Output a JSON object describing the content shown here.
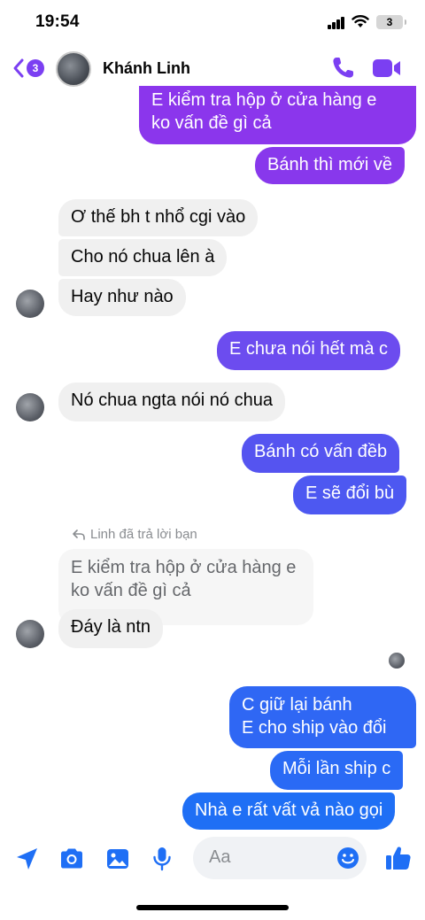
{
  "status": {
    "time": "19:54",
    "battery": "3"
  },
  "header": {
    "back_count": "3",
    "contact_name": "Khánh Linh"
  },
  "messages": [
    {
      "from": "me",
      "lines": [
        "E kiểm tra hộp ở cửa hàng e",
        "ko vấn đề gì cả"
      ]
    },
    {
      "from": "me",
      "lines": [
        "Bánh thì mới về"
      ]
    },
    {
      "from": "them",
      "lines": [
        "Ơ thế bh t nhổ cgi vào"
      ]
    },
    {
      "from": "them",
      "lines": [
        "Cho nó chua lên à"
      ]
    },
    {
      "from": "them",
      "lines": [
        "Hay như nào"
      ]
    },
    {
      "from": "me",
      "lines": [
        "E chưa nói hết mà c"
      ]
    },
    {
      "from": "them",
      "lines": [
        "Nó chua ngta nói nó chua"
      ]
    },
    {
      "from": "me",
      "lines": [
        "Bánh có vấn đềb"
      ]
    },
    {
      "from": "me",
      "lines": [
        "E sẽ đổi bù"
      ]
    },
    {
      "from": "them",
      "lines": [
        "Đáy là ntn"
      ]
    },
    {
      "from": "me",
      "lines": [
        "C giữ lại bánh",
        "E cho ship vào đổi"
      ]
    },
    {
      "from": "me",
      "lines": [
        "Mỗi lần ship c"
      ]
    },
    {
      "from": "me",
      "lines": [
        "Nhà e rất vất vả nào gọi"
      ]
    }
  ],
  "reply": {
    "label": "Linh đã trả lời bạn",
    "quoted": "E kiểm tra hộp ở cửa hàng e ko vấn đề gì cả"
  },
  "composer": {
    "placeholder": "Aa"
  },
  "colors": {
    "accent": "#7b3ff2",
    "bubble_top": "#8a35ec",
    "bubble_bottom": "#1f6ff5",
    "incoming": "#f0f0f0"
  },
  "icons": [
    "back-chevron-icon",
    "phone-icon",
    "video-camera-icon",
    "send-location-icon",
    "camera-icon",
    "image-icon",
    "microphone-icon",
    "emoji-icon",
    "thumbs-up-icon",
    "reply-arrow-icon"
  ]
}
